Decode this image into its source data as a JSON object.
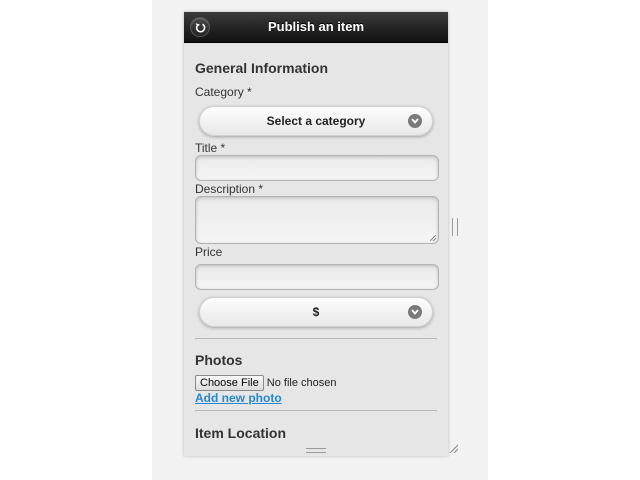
{
  "header": {
    "title": "Publish an item",
    "back_icon": "back-arrow-icon"
  },
  "general": {
    "heading": "General Information",
    "category_label": "Category *",
    "category_select": "Select a category",
    "title_label": "Title *",
    "title_value": "",
    "description_label": "Description *",
    "description_value": "",
    "price_label": "Price",
    "price_value": "",
    "currency_select": "$"
  },
  "photos": {
    "heading": "Photos",
    "choose_file_label": "Choose File",
    "no_file_text": "No file chosen",
    "add_photo_link": "Add new photo"
  },
  "location": {
    "heading": "Item Location"
  },
  "colors": {
    "header_bg": "#1a1a1a",
    "link": "#2489ce",
    "content_bg": "#e6e6e6"
  }
}
